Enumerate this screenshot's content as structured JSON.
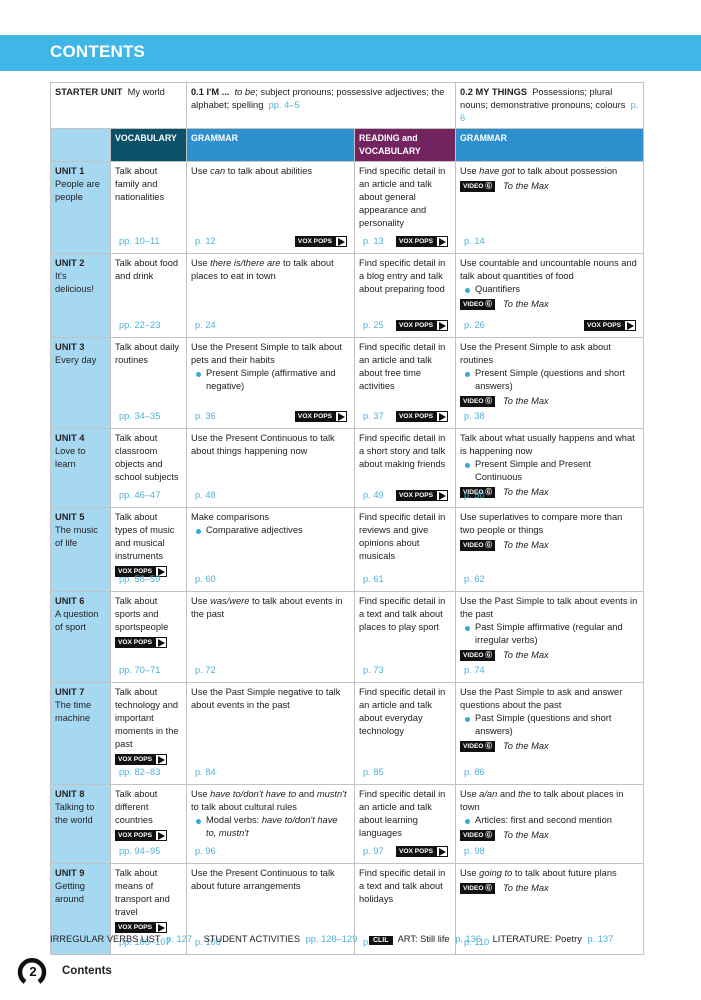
{
  "header": {
    "title": "CONTENTS"
  },
  "starter": {
    "label": "STARTER UNIT",
    "name": "My world",
    "part1": {
      "title": "0.1 I'M ...",
      "italic": "to be",
      "text": "; subject pronouns; possessive adjectives; the alphabet; spelling",
      "pages": "pp. 4–5"
    },
    "part2": {
      "title": "0.2 MY THINGS",
      "text": "Possessions; plural nouns; demonstrative pronouns; colours",
      "pages": "p. 6"
    }
  },
  "columns": [
    "",
    "VOCABULARY",
    "GRAMMAR",
    "READING and VOCABULARY",
    "GRAMMAR"
  ],
  "badges": {
    "vox_pops": "VOX POPS",
    "video": "VIDEO ☉",
    "video_label": "VIDEO",
    "video_title": "To the Max",
    "clil": "CLIL"
  },
  "units": [
    {
      "label": "UNIT 1",
      "name": "People are people",
      "vocab": {
        "text": "Talk about family and nationalities",
        "pages": "pp. 10–11",
        "vox": false
      },
      "grammar": {
        "pre": "Use ",
        "it": "can",
        "post": " to talk about abilities",
        "bullet": "",
        "pages": "p. 12",
        "vox": true
      },
      "reading": {
        "text": "Find specific detail in an article and talk about general appearance and personality",
        "pages": "p. 13",
        "vox": true
      },
      "grammar2": {
        "pre": "Use ",
        "it": "have got",
        "post": " to talk about possession",
        "bullet": "",
        "video": true,
        "pages": "p. 14",
        "vox": false
      }
    },
    {
      "label": "UNIT 2",
      "name": "It's delicious!",
      "vocab": {
        "text": "Talk about food and drink",
        "pages": "pp. 22–23",
        "vox": false
      },
      "grammar": {
        "pre": "Use ",
        "it": "there is/there are",
        "post": " to talk about places to eat in town",
        "bullet": "",
        "pages": "p. 24",
        "vox": false
      },
      "reading": {
        "text": "Find specific detail in a blog entry and talk about preparing food",
        "pages": "p. 25",
        "vox": true
      },
      "grammar2": {
        "pre": "Use countable and uncountable nouns and talk about quantities of food",
        "it": "",
        "post": "",
        "bullet": "Quantifiers",
        "video": true,
        "pages": "p. 26",
        "vox": true
      }
    },
    {
      "label": "UNIT 3",
      "name": "Every day",
      "vocab": {
        "text": "Talk about daily routines",
        "pages": "pp. 34–35",
        "vox": false
      },
      "grammar": {
        "pre": "Use the Present Simple to talk about pets and their habits",
        "it": "",
        "post": "",
        "bullet": "Present Simple (affirmative and negative)",
        "pages": "p. 36",
        "vox": true
      },
      "reading": {
        "text": "Find specific detail in an article and talk about free time activities",
        "pages": "p. 37",
        "vox": true
      },
      "grammar2": {
        "pre": "Use the Present Simple to ask about routines",
        "it": "",
        "post": "",
        "bullet": "Present Simple (questions and short answers)",
        "video": true,
        "pages": "p. 38",
        "vox": false
      }
    },
    {
      "label": "UNIT 4",
      "name": "Love to learn",
      "vocab": {
        "text": "Talk about classroom objects and school subjects",
        "pages": "pp. 46–47",
        "vox": false
      },
      "grammar": {
        "pre": "Use the Present Continuous to talk about things happening now",
        "it": "",
        "post": "",
        "bullet": "",
        "pages": "p. 48",
        "vox": false
      },
      "reading": {
        "text": "Find specific detail in a short story and talk about making friends",
        "pages": "p. 49",
        "vox": true
      },
      "grammar2": {
        "pre": "Talk about what usually happens and what is happening now",
        "it": "",
        "post": "",
        "bullet": "Present Simple and Present Continuous",
        "video": true,
        "pages": "p. 50",
        "vox": false
      }
    },
    {
      "label": "UNIT 5",
      "name": "The music of life",
      "vocab": {
        "text": "Talk about types of music and musical instruments",
        "pages": "pp. 58–59",
        "vox": true
      },
      "grammar": {
        "pre": "Make comparisons",
        "it": "",
        "post": "",
        "bullet": "Comparative adjectives",
        "pages": "p. 60",
        "vox": false
      },
      "reading": {
        "text": "Find specific detail in reviews and give opinions about musicals",
        "pages": "p. 61",
        "vox": false
      },
      "grammar2": {
        "pre": "Use superlatives to compare more than two people or things",
        "it": "",
        "post": "",
        "bullet": "",
        "video": true,
        "pages": "p. 62",
        "vox": false
      }
    },
    {
      "label": "UNIT 6",
      "name": "A question of sport",
      "vocab": {
        "text": "Talk about sports and sportspeople",
        "pages": "pp. 70–71",
        "vox": true
      },
      "grammar": {
        "pre": "Use ",
        "it": "was/were",
        "post": " to talk about events in the past",
        "bullet": "",
        "pages": "p. 72",
        "vox": false
      },
      "reading": {
        "text": "Find specific detail in a text and talk about places to play sport",
        "pages": "p. 73",
        "vox": false
      },
      "grammar2": {
        "pre": "Use the Past Simple to talk about events in the past",
        "it": "",
        "post": "",
        "bullet": "Past Simple affirmative (regular and irregular verbs)",
        "video": true,
        "pages": "p. 74",
        "vox": false
      }
    },
    {
      "label": "UNIT 7",
      "name": "The time machine",
      "vocab": {
        "text": "Talk about technology and important moments in the past",
        "pages": "pp. 82–83",
        "vox": true
      },
      "grammar": {
        "pre": "Use the Past Simple negative to talk about events in the past",
        "it": "",
        "post": "",
        "bullet": "",
        "pages": "p. 84",
        "vox": false
      },
      "reading": {
        "text": "Find specific detail in an article and talk about everyday technology",
        "pages": "p. 85",
        "vox": false
      },
      "grammar2": {
        "pre": "Use the Past Simple to ask and answer questions about the past",
        "it": "",
        "post": "",
        "bullet": "Past Simple (questions and short answers)",
        "video": true,
        "pages": "p. 86",
        "vox": false
      }
    },
    {
      "label": "UNIT 8",
      "name": "Talking to the world",
      "vocab": {
        "text": "Talk about different countries",
        "pages": "pp. 94–95",
        "vox": true
      },
      "grammar": {
        "pre": "Use ",
        "it": "have to/don't have to",
        "post": " and ",
        "it2": "mustn't",
        "post2": " to talk about cultural rules",
        "bullet": "Modal verbs: ",
        "bullet_it": "have to/don't have to, mustn't",
        "pages": "p. 96",
        "vox": false
      },
      "reading": {
        "text": "Find specific detail in an article and talk about learning languages",
        "pages": "p. 97",
        "vox": true
      },
      "grammar2": {
        "pre": "Use ",
        "it": "a/an",
        "post": " and ",
        "it2": "the",
        "post2": " to talk about places in town",
        "bullet": "Articles: first and second mention",
        "video": true,
        "pages": "p. 98",
        "vox": false
      }
    },
    {
      "label": "UNIT 9",
      "name": "Getting around",
      "vocab": {
        "text": "Talk about means of transport and travel",
        "pages": "pp. 106–107",
        "vox": true
      },
      "grammar": {
        "pre": "Use the Present Continuous to talk about future arrangements",
        "it": "",
        "post": "",
        "bullet": "",
        "pages": "p. 108",
        "vox": false
      },
      "reading": {
        "text": "Find specific detail in a text and talk about holidays",
        "pages": "p. 109",
        "vox": false
      },
      "grammar2": {
        "pre": "Use ",
        "it": "going to",
        "post": " to talk about future plans",
        "bullet": "",
        "video": true,
        "pages": "p. 110",
        "vox": false
      }
    }
  ],
  "footer": {
    "irregular": {
      "label": "IRREGULAR VERBS LIST",
      "pages": "p. 127"
    },
    "activities": {
      "label": "STUDENT ACTIVITIES",
      "pages": "pp. 128–129"
    },
    "clil": "CLIL",
    "art": {
      "label": "ART: Still life",
      "pages": "p. 136"
    },
    "literature": {
      "label": "LITERATURE: Poetry",
      "pages": "p. 137"
    }
  },
  "page": {
    "number": "2",
    "label": "Contents"
  },
  "colors": {
    "banner": "#3fb6e6",
    "unit_bg": "#a7d8f2",
    "vocab_hdr": "#0b5168",
    "grammar_hdr": "#2e8fcf",
    "reading_hdr": "#73245f",
    "page_ref": "#4cb3d8"
  }
}
